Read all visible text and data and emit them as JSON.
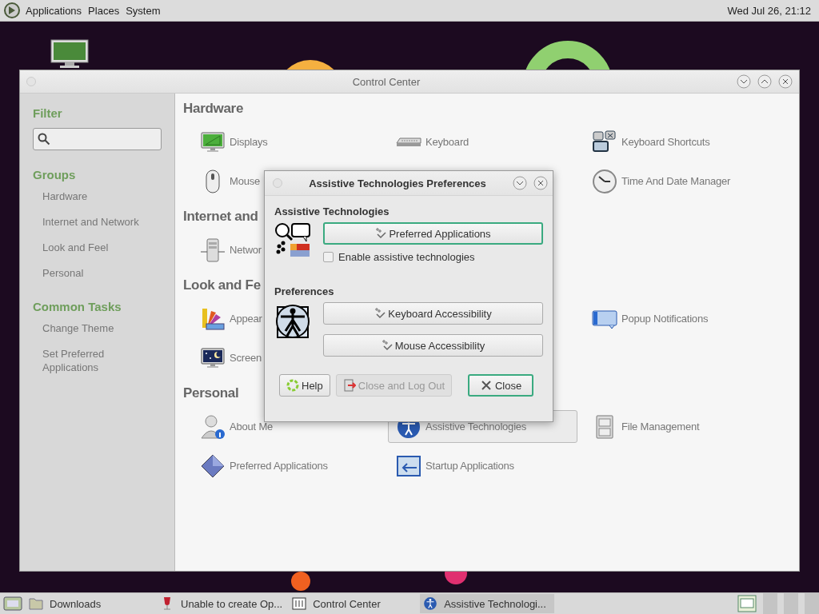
{
  "top_panel": {
    "menus": [
      "Applications",
      "Places",
      "System"
    ],
    "clock": "Wed Jul 26, 21:12"
  },
  "control_center": {
    "title": "Control Center",
    "sidebar": {
      "filter_heading": "Filter",
      "groups_heading": "Groups",
      "groups": [
        "Hardware",
        "Internet and Network",
        "Look and Feel",
        "Personal"
      ],
      "tasks_heading": "Common Tasks",
      "tasks": [
        "Change Theme",
        "Set Preferred Applications"
      ]
    },
    "sections": [
      {
        "title": "Hardware",
        "rows": [
          [
            {
              "label": "Displays",
              "kind": "display",
              "selected": false
            },
            {
              "label": "Keyboard",
              "kind": "keyboard",
              "selected": false
            },
            {
              "label": "Keyboard Shortcuts",
              "kind": "shortcuts",
              "selected": false
            }
          ],
          [
            {
              "label": "Mouse",
              "kind": "mouse",
              "selected": false
            },
            null,
            {
              "label": "Time And Date Manager",
              "kind": "clock",
              "selected": false
            }
          ]
        ]
      },
      {
        "title": "Internet and",
        "rows": [
          [
            {
              "label": "Networ",
              "kind": "network",
              "selected": false
            }
          ]
        ]
      },
      {
        "title": "Look and Fe",
        "rows": [
          [
            {
              "label": "Appear",
              "kind": "appearance",
              "selected": false
            },
            null,
            {
              "label": "Popup Notifications",
              "kind": "popup",
              "selected": false
            }
          ],
          [
            {
              "label": "Screen",
              "kind": "screensaver",
              "selected": false
            }
          ]
        ]
      },
      {
        "title": "Personal",
        "rows": [
          [
            {
              "label": "About Me",
              "kind": "person",
              "selected": false
            },
            {
              "label": "Assistive Technologies",
              "kind": "access",
              "selected": true
            },
            {
              "label": "File Management",
              "kind": "files",
              "selected": false
            }
          ],
          [
            {
              "label": "Preferred Applications",
              "kind": "diamond",
              "selected": false
            },
            {
              "label": "Startup Applications",
              "kind": "startup",
              "selected": false
            }
          ]
        ]
      }
    ]
  },
  "dialog": {
    "title": "Assistive Technologies Preferences",
    "section_1": {
      "heading": "Assistive Technologies",
      "button": {
        "label": "Preferred Applications",
        "focused": true
      },
      "checkbox": {
        "label": "Enable assistive technologies",
        "checked": false
      }
    },
    "section_2": {
      "heading": "Preferences",
      "buttons": [
        {
          "label": "Keyboard Accessibility",
          "focused": false
        },
        {
          "label": "Mouse Accessibility",
          "focused": false
        }
      ]
    },
    "footer": [
      {
        "label": "Help",
        "kind": "help",
        "disabled": false,
        "focused": false
      },
      {
        "label": "Close and Log Out",
        "kind": "logout",
        "disabled": true,
        "focused": false
      },
      {
        "label": "Close",
        "kind": "close",
        "disabled": false,
        "focused": true
      }
    ]
  },
  "taskbar": {
    "items": [
      {
        "label": "Downloads",
        "kind": "folder",
        "selected": false
      },
      {
        "label": "Unable to create Op...",
        "kind": "wine",
        "selected": false
      },
      {
        "label": "Control Center",
        "kind": "panel",
        "selected": false
      },
      {
        "label": "Assistive Technologi...",
        "kind": "access",
        "selected": true
      }
    ]
  }
}
